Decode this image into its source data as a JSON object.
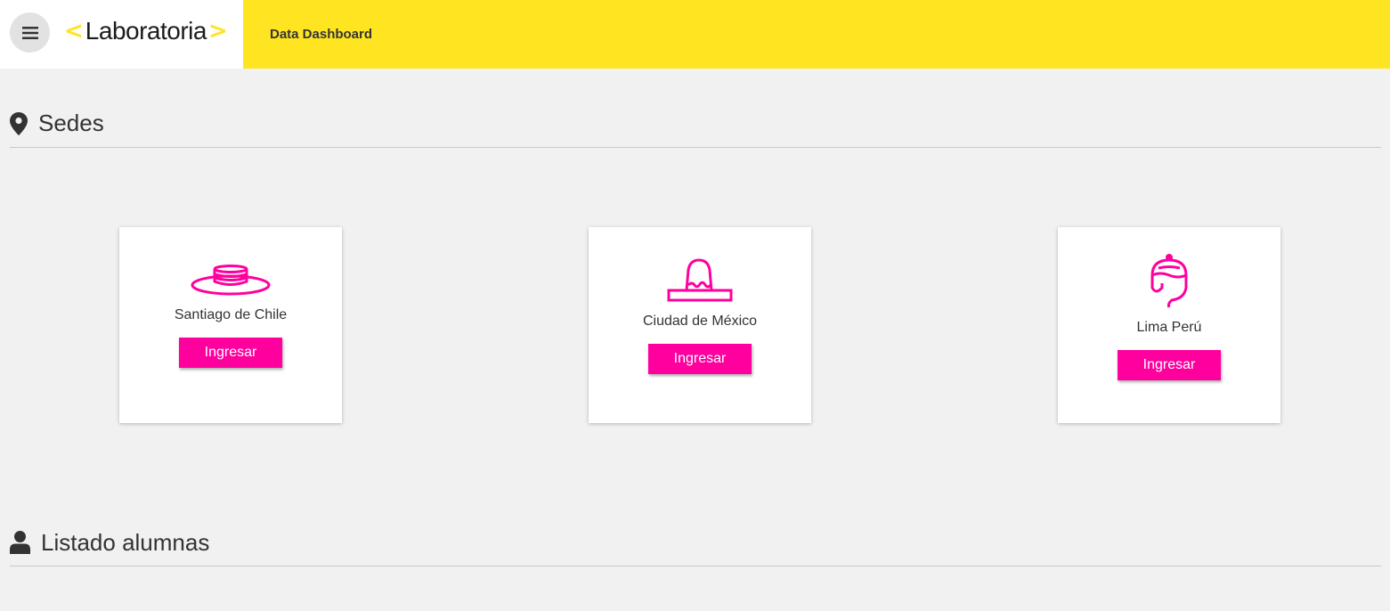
{
  "header": {
    "logo_text": "Laboratoria",
    "logo_left": "<",
    "logo_right": ">",
    "title": "Data Dashboard",
    "menu_icon": "hamburger-icon"
  },
  "colors": {
    "yellow": "#ffe521",
    "magenta": "#ff009e",
    "background": "#f1f1f1"
  },
  "sedes": {
    "heading": "Sedes",
    "icon": "map-marker-icon",
    "cards": [
      {
        "city": "Santiago de Chile",
        "button": "Ingresar",
        "icon": "chilean-hat-icon"
      },
      {
        "city": "Ciudad de México",
        "button": "Ingresar",
        "icon": "sombrero-icon"
      },
      {
        "city": "Lima Perú",
        "button": "Ingresar",
        "icon": "chullo-hat-icon"
      }
    ]
  },
  "alumnas": {
    "heading": "Listado alumnas",
    "icon": "user-icon"
  }
}
